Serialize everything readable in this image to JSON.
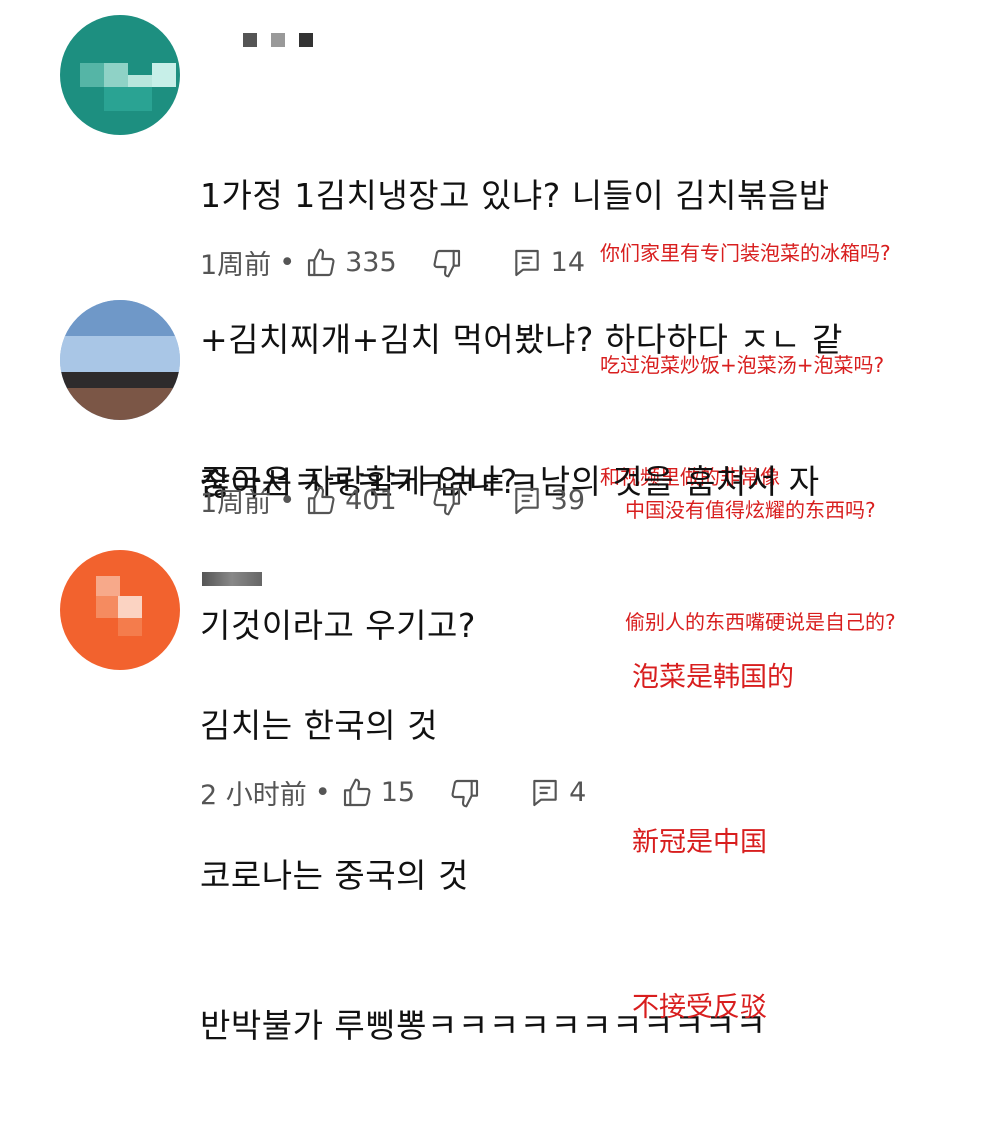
{
  "comments": [
    {
      "avatar_color": "#1d8f80",
      "text_lines": [
        "1가정 1김치냉장고 있냐? 니들이 김치볶음밥",
        "+김치찌개+김치 먹어봤냐? 하다하다 ㅈㄴ 같",
        "잖아서ㅋㅋㅋㅋㅋㅋㅌㅋ"
      ],
      "time": "1周前",
      "likes": "335",
      "replies": "14",
      "annotation_lines": [
        "你们家里有专门装泡菜的冰箱吗?",
        "吃过泡菜炒饭+泡菜汤+泡菜吗?",
        "和视频里做的非常像"
      ]
    },
    {
      "avatar_color": "#6f98c8",
      "text_lines": [
        "중국은 자랑할게 없나?  남의 것을 훔쳐서 자",
        "기것이라고 우기고?"
      ],
      "time": "1周前",
      "likes": "401",
      "replies": "39",
      "annotation_lines": [
        "中国没有值得炫耀的东西吗?",
        "偷别人的东西嘴硬说是自己的?"
      ]
    },
    {
      "avatar_color": "#f2622e",
      "text_lines": [
        "김치는 한국의 것",
        "코로나는 중국의 것",
        "반박불가 루삥뽕ㅋㅋㅋㅋㅋㅋㅋㅋㅋㅋㅋ"
      ],
      "time": "2 小时前",
      "likes": "15",
      "replies": "4",
      "annotation_lines": [
        "泡菜是韩国的",
        "新冠是中国",
        "不接受反驳"
      ]
    }
  ],
  "meta_separator": "•",
  "icons": {
    "like": "thumbs-up-icon",
    "dislike": "thumbs-down-icon",
    "reply": "comment-icon"
  },
  "colors": {
    "annotation": "#d81e1e",
    "meta_text": "#555555"
  }
}
